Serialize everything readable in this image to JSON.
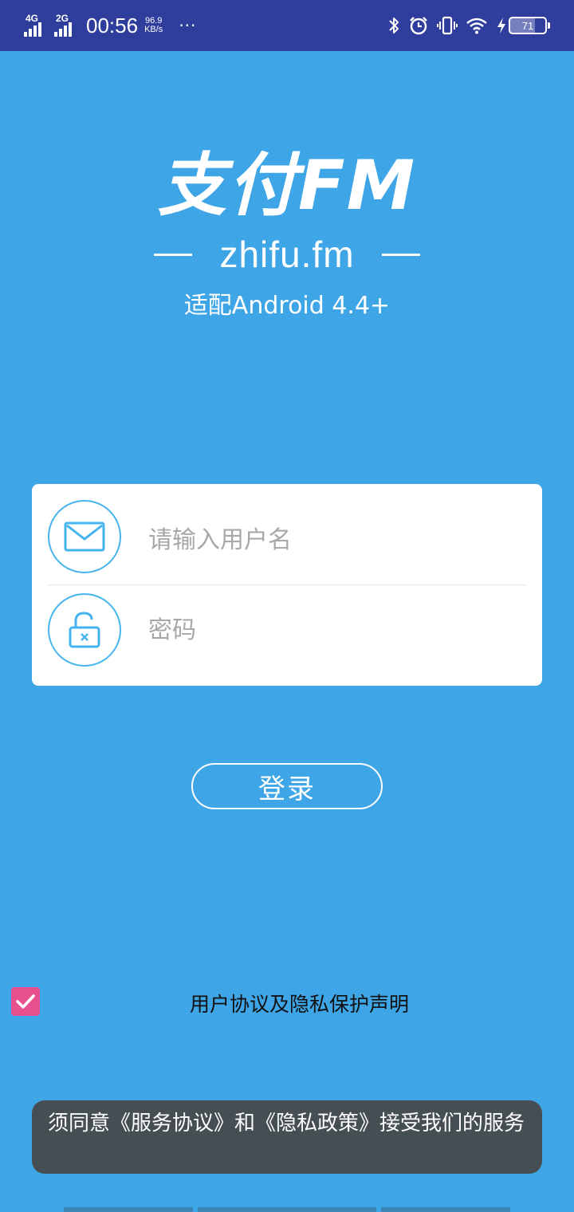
{
  "status_bar": {
    "network_1": "4G",
    "network_2": "2G",
    "time": "00:56",
    "speed_value": "96.9",
    "speed_unit": "KB/s",
    "more": "···",
    "battery": "71",
    "battery_level": 0.71,
    "icons": [
      "bluetooth-icon",
      "alarm-icon",
      "vibrate-icon",
      "wifi-icon",
      "charging-icon",
      "battery-icon"
    ]
  },
  "header": {
    "app_title": "支付FM",
    "domain_dash_left": "—",
    "domain": "zhifu.fm",
    "domain_dash_right": "—",
    "compat": "适配Android 4.4+"
  },
  "login_form": {
    "username_placeholder": "请输入用户名",
    "username_value": "",
    "password_placeholder": "密码",
    "password_value": "",
    "icons": [
      "mail-icon",
      "unlock-icon"
    ]
  },
  "login_button": "登录",
  "agreement": {
    "checked": true,
    "label": "用户协议及隐私保护声明"
  },
  "toast": "须同意《服务协议》和《隐私政策》接受我们的服务",
  "colors": {
    "background": "#3ea5e6",
    "status_bar": "#2f3d9d",
    "checkbox": "#e84f8e",
    "toast": "#454e52",
    "icon_accent": "#45b4ee"
  }
}
